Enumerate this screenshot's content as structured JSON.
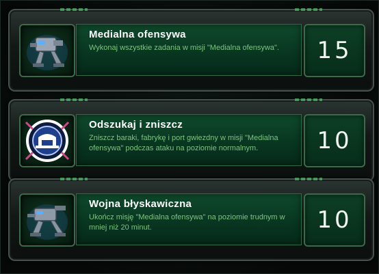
{
  "achievements": [
    {
      "title": "Medialna ofensywa",
      "description": "Wykonaj wszystkie zadania w misji \"Medialna ofensywa\".",
      "points": "15",
      "icon": "mech-walker-icon"
    },
    {
      "title": "Odszukaj i zniszcz",
      "description": "Zniszcz baraki, fabrykę i port gwiezdny w misji \"Medialna ofensywa\" podczas ataku na poziomie normalnym.",
      "points": "10",
      "icon": "target-bunker-icon"
    },
    {
      "title": "Wojna błyskawiczna",
      "description": "Ukończ misję \"Medialna ofensywa\" na poziomie trudnym w mniej niż 20 minut.",
      "points": "10",
      "icon": "mech-walker-icon"
    }
  ],
  "colors": {
    "title": "#ffffff",
    "description": "#7dc47f",
    "panel_green": "#0f4a2c"
  }
}
